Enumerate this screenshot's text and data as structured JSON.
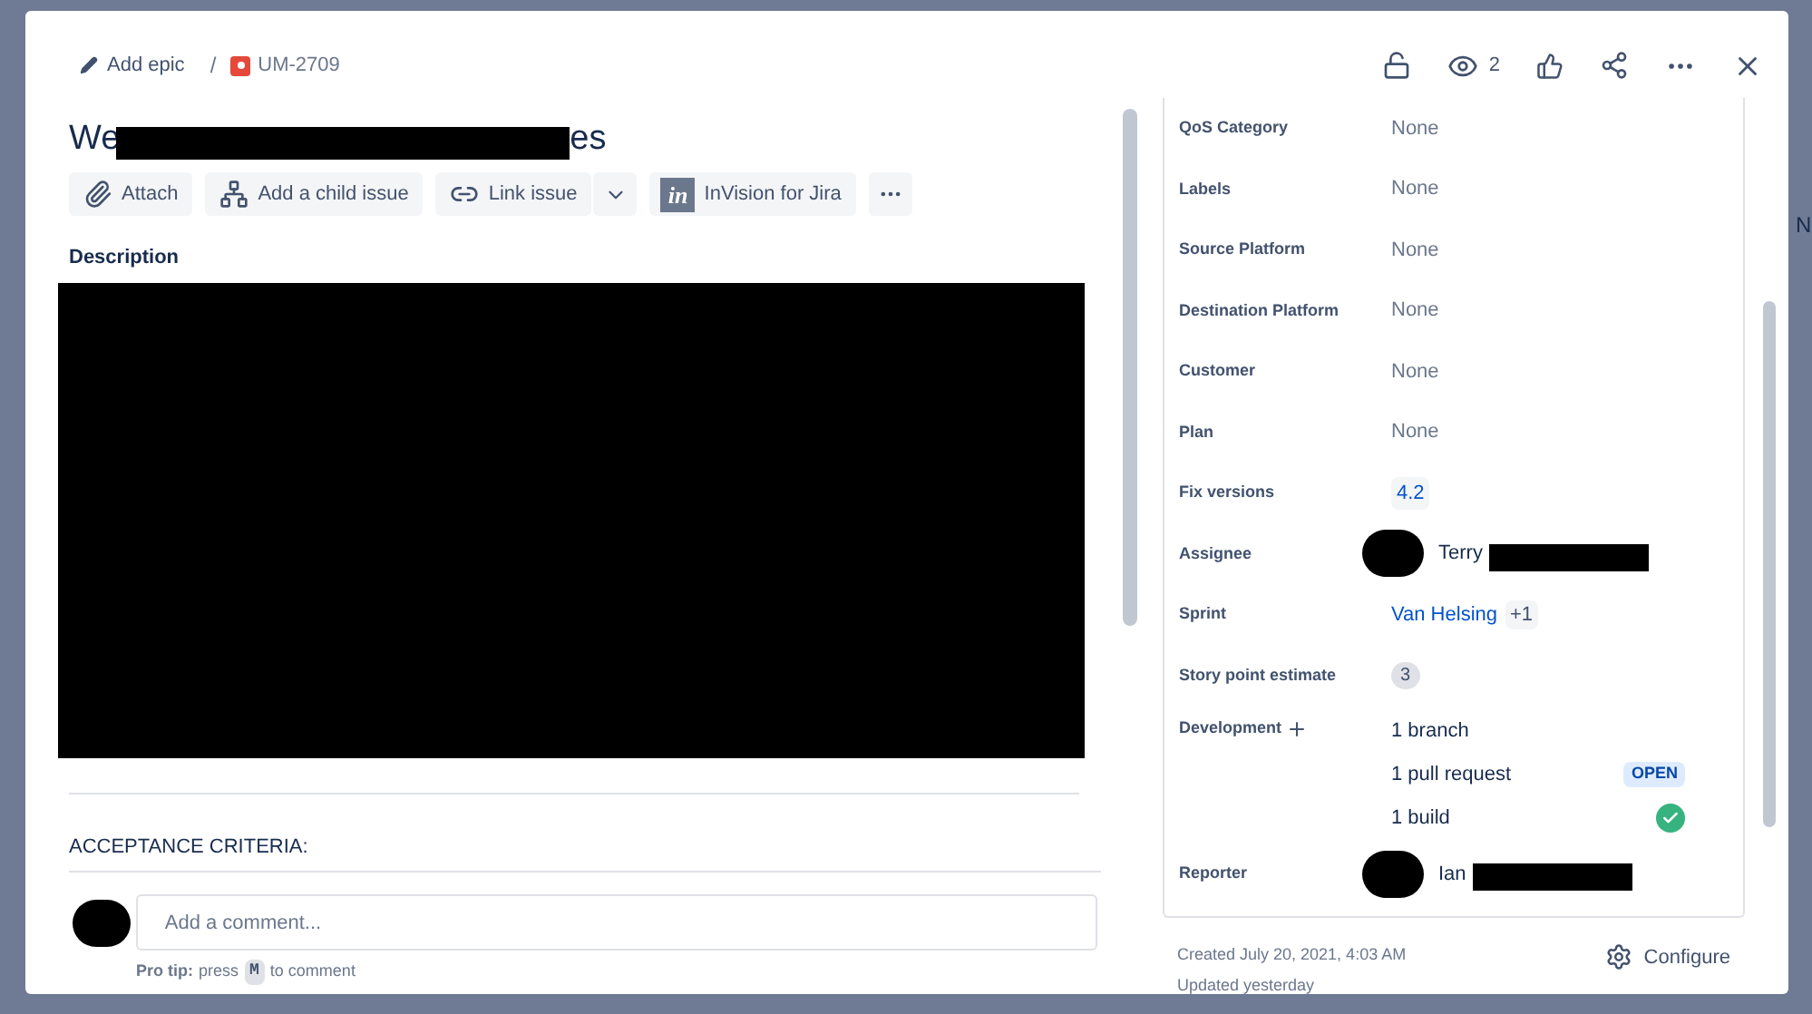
{
  "breadcrumb": {
    "epic_action": "Add epic",
    "separator": "/",
    "issue_key": "UM-2709"
  },
  "header_actions": {
    "watchers": "2"
  },
  "title": {
    "start": "We",
    "end": "es"
  },
  "toolbar": [
    {
      "label": "Attach",
      "kind": "attach"
    },
    {
      "label": "Add a child issue",
      "kind": "child"
    },
    {
      "label": "Link issue",
      "kind": "link"
    },
    {
      "label": "InVision for Jira",
      "kind": "invision",
      "logo": "in"
    }
  ],
  "description": {
    "label": "Description"
  },
  "acceptance": {
    "label": "ACCEPTANCE CRITERIA:"
  },
  "comment": {
    "placeholder": "Add a comment...",
    "tip_lead": "Pro tip:",
    "tip_press": "press",
    "tip_key": "M",
    "tip_rest": "to comment"
  },
  "fields": [
    {
      "label": "QoS Category",
      "kind": "text",
      "value": "None"
    },
    {
      "label": "Labels",
      "kind": "text",
      "value": "None"
    },
    {
      "label": "Source Platform",
      "kind": "text",
      "value": "None"
    },
    {
      "label": "Destination Platform",
      "kind": "text",
      "value": "None"
    },
    {
      "label": "Customer",
      "kind": "text",
      "value": "None"
    },
    {
      "label": "Plan",
      "kind": "text",
      "value": "None"
    },
    {
      "label": "Fix versions",
      "kind": "tag",
      "value": "4.2"
    },
    {
      "label": "Assignee",
      "kind": "user",
      "value": "Terry"
    },
    {
      "label": "Sprint",
      "kind": "sprint",
      "value": "Van Helsing",
      "extra": "+1"
    },
    {
      "label": "Story point estimate",
      "kind": "count",
      "value": "3"
    },
    {
      "label": "Development",
      "kind": "development",
      "items": [
        {
          "text": "1 branch",
          "kind": "plain"
        },
        {
          "text": "1 pull request",
          "kind": "lozenge",
          "badge": "OPEN"
        },
        {
          "text": "1 build",
          "kind": "success"
        }
      ]
    },
    {
      "label": "Reporter",
      "kind": "user",
      "value": "Ian"
    }
  ],
  "footer": {
    "created": "Created July 20, 2021, 4:03 AM",
    "updated": "Updated yesterday",
    "configure": "Configure"
  },
  "backdrop": {
    "peek_text": "N"
  }
}
